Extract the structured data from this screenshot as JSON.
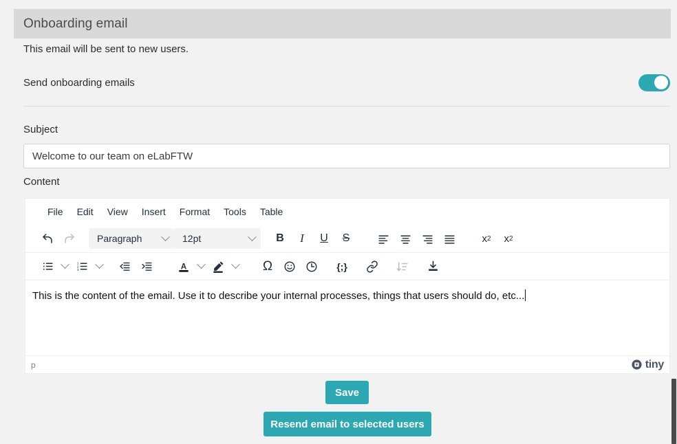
{
  "panel": {
    "title": "Onboarding email",
    "intro_text": "This email will be sent to new users."
  },
  "toggle": {
    "label": "Send onboarding emails",
    "state": "on",
    "accent_color": "#2ba8b1"
  },
  "subject": {
    "label": "Subject",
    "value": "Welcome to our team on eLabFTW",
    "placeholder": "Subject"
  },
  "content": {
    "label": "Content",
    "body_text": "This is the content of the email. Use it to describe your internal processes, things that users should do, etc...",
    "element_path": "p",
    "branding": "tiny"
  },
  "editor": {
    "menubar": [
      {
        "label": "File"
      },
      {
        "label": "Edit"
      },
      {
        "label": "View"
      },
      {
        "label": "Insert"
      },
      {
        "label": "Format"
      },
      {
        "label": "Tools"
      },
      {
        "label": "Table"
      }
    ],
    "toolbar_row1": {
      "undo": "undo-icon",
      "redo": "redo-icon",
      "block_format": "Paragraph",
      "font_size": "12pt",
      "bold": "B",
      "italic": "I",
      "underline": "U",
      "strikethrough": "S",
      "align_left": "align-left-icon",
      "align_center": "align-center-icon",
      "align_right": "align-right-icon",
      "align_justify": "align-justify-icon",
      "superscript": "x",
      "superscript_exp": "2",
      "subscript": "x",
      "subscript_exp": "2"
    },
    "toolbar_row2": {
      "bullet_list": "bullet-list-icon",
      "numbered_list": "numbered-list-icon",
      "outdent": "outdent-icon",
      "indent": "indent-icon",
      "text_color": "A",
      "background_color": "highlight-pen-icon",
      "special_character": "Ω",
      "emoticons": "emoji-icon",
      "insert_datetime": "clock-icon",
      "source_code": "{;}",
      "link": "link-icon",
      "sort": "sort-icon",
      "save": "save-icon"
    }
  },
  "actions": {
    "save_label": "Save",
    "resend_label": "Resend email to selected users",
    "button_color": "#2ba8b1"
  }
}
